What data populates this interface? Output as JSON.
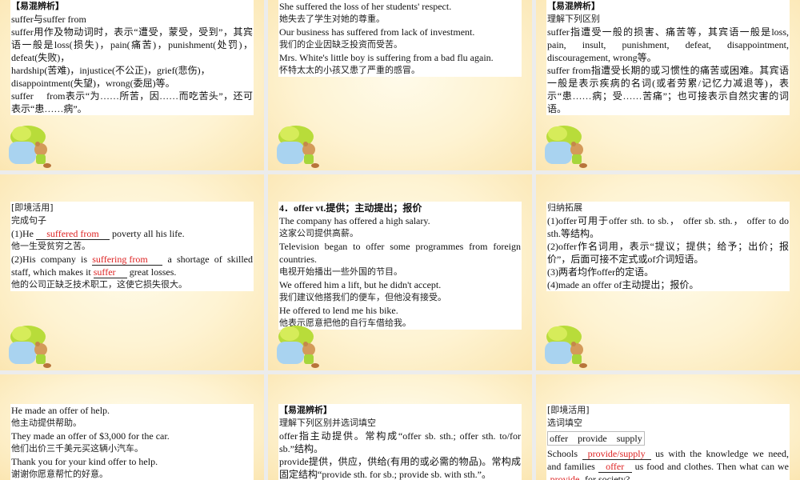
{
  "slides": [
    {
      "lines": [
        "【易混辨析】",
        "suffer与suffer from",
        "suffer用作及物动词时，表示“遭受，蒙受，受到”，其宾语一般是loss(损失)，pain(痛苦)，punishment(处罚)，defeat(失败)，",
        "hardship(苦难)，injustice(不公正)，grief(悲伤)，",
        "disappointment(失望)，wrong(委屈)等。",
        "suffer　 from表示“为……所苦，因……而吃苦头”，还可表示“患……病”。"
      ]
    },
    {
      "lines": [
        "She suffered the loss of her students' respect.",
        "她失去了学生对她的尊重。",
        "Our business has suffered from lack of investment.",
        "我们的企业因缺乏投资而受苦。",
        "Mrs. White's little boy is suffering from a bad flu again.",
        "怀特太太的小孩又患了严重的感冒。"
      ]
    },
    {
      "lines": [
        "【易混辨析】",
        "理解下列区别",
        "suffer指遭受一般的损害、痛苦等，其宾语一般是loss,　　 pain, insult, punishment, defeat, disappointment, discouragement, wrong等。",
        "suffer from指遭受长期的或习惯性的痛苦或困难。其宾语一般是表示疾病的名词(或者劳累/记忆力减退等)，表示“患……病；受……苦痛”；也可接表示自然灾害的词语。"
      ]
    },
    {
      "heading": "[即境活用]",
      "sub": "完成句子",
      "q1_pre": "(1)He ",
      "q1_ans": "suffered from",
      "q1_post": " poverty all his life.",
      "q1_zh": "他一生受贫穷之苦。",
      "q2_pre": "(2)His company is ",
      "q2_ans1": "suffering from",
      "q2_mid": " a shortage of skilled staff, which makes it ",
      "q2_ans2": "suffer",
      "q2_post": " great losses.",
      "q2_zh": "他的公司正缺乏技术职工，这使它损失很大。"
    },
    {
      "heading": "4．offer vt.提供；主动提出；报价",
      "lines": [
        "The company has offered a high salary.",
        "这家公司提供高薪。",
        "Television began to offer some programmes from foreign countries.",
        "电视开始播出一些外国的节目。",
        "We offered him a lift, but he didn't accept.",
        "我们建议他搭我们的便车，但他没有接受。",
        "He offered to lend me his bike.",
        "他表示愿意把他的自行车借给我。"
      ]
    },
    {
      "heading": "归纳拓展",
      "lines": [
        "(1)offer可用于offer sth. to sb.， offer sb. sth.， offer to do sth.等结构。",
        "(2)offer作名词用，表示“提议；提供；给予；出价；报价”，后面可接不定式或of介词短语。",
        "(3)两者均作offer的定语。",
        "(4)made an offer of主动提出；报价。"
      ]
    },
    {
      "lines": [
        "He made an offer of help.",
        "他主动提供帮助。",
        "They made an offer of $3,000 for the car.",
        "他们出价三千美元买这辆小汽车。",
        "Thank you for your kind offer to help.",
        "谢谢你愿意帮忙的好意。"
      ]
    },
    {
      "heading": "【易混辨析】",
      "lines": [
        "理解下列区别并选词填空",
        "offer指主动提供。常构成“offer sb. sth.; offer sth. to/for sb.”结构。",
        "provide提供，供应，供给(有用的或必需的物品)。常构成固定结构“provide sth. for sb.; provide sb. with sth.”。"
      ]
    },
    {
      "heading": "[即境活用]",
      "sub": "选词填空",
      "words": "offer　provide　supply",
      "s_pre": "Schools ",
      "ans1": "provide/supply",
      "s_mid1": " us with the knowledge we need, and families ",
      "ans2": "offer",
      "s_mid2": " us food and clothes. Then what can we ",
      "ans3": "provide",
      "s_post": " for society?"
    }
  ],
  "colors": {
    "answer": "#dd2222",
    "background": "#fef3d2"
  }
}
